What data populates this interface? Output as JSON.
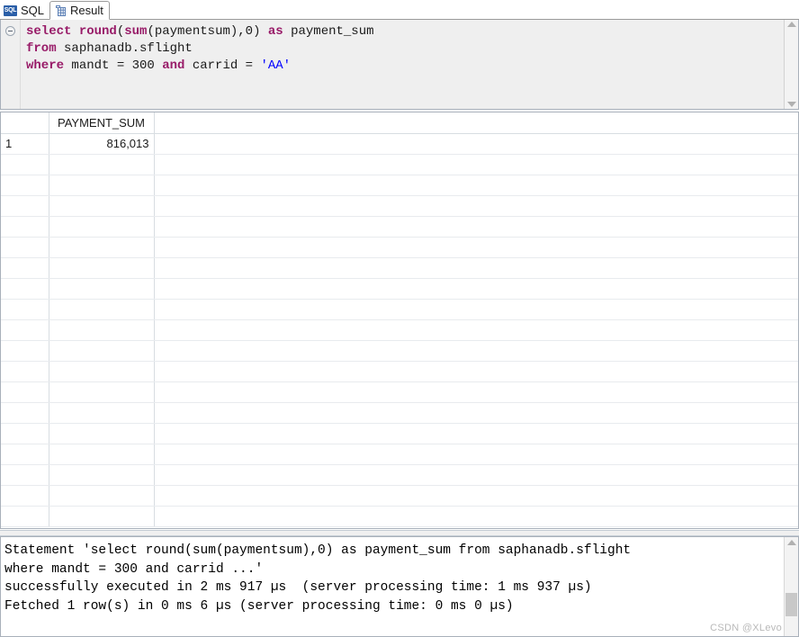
{
  "tabs": [
    {
      "label": "SQL",
      "icon": "sql-badge-icon",
      "active": false
    },
    {
      "label": "Result",
      "icon": "table-grid-icon",
      "active": true
    }
  ],
  "editor": {
    "fold_marker": "collapse-minus",
    "lines": [
      {
        "tokens": [
          {
            "t": "select ",
            "k": "kw"
          },
          {
            "t": "round",
            "k": "kw"
          },
          {
            "t": "(",
            "k": ""
          },
          {
            "t": "sum",
            "k": "kw"
          },
          {
            "t": "(paymentsum),0)",
            "k": ""
          },
          {
            "t": " as ",
            "k": "kw"
          },
          {
            "t": "payment_sum",
            "k": ""
          }
        ]
      },
      {
        "tokens": [
          {
            "t": "from",
            "k": "kw"
          },
          {
            "t": " saphanadb.sflight",
            "k": ""
          }
        ]
      },
      {
        "tokens": [
          {
            "t": "where",
            "k": "kw"
          },
          {
            "t": " mandt = 300 ",
            "k": ""
          },
          {
            "t": "and",
            "k": "kw"
          },
          {
            "t": " carrid = ",
            "k": ""
          },
          {
            "t": "'AA'",
            "k": "str"
          }
        ]
      }
    ],
    "scroll_up": "scroll-up-arrow",
    "scroll_down": "scroll-down-arrow"
  },
  "grid": {
    "columns": [
      "",
      "PAYMENT_SUM"
    ],
    "rows": [
      {
        "num": "1",
        "values": [
          "816,013"
        ]
      }
    ],
    "empty_row_count": 18
  },
  "console": {
    "lines": [
      "Statement 'select round(sum(paymentsum),0) as payment_sum from saphanadb.sflight",
      "where mandt = 300 and carrid ...'",
      "successfully executed in 2 ms 917 µs  (server processing time: 1 ms 937 µs)",
      "Fetched 1 row(s) in 0 ms 6 µs (server processing time: 0 ms 0 µs)"
    ]
  },
  "watermark": {
    "text": "CSDN @XLevo"
  },
  "colors": {
    "keyword": "#981b68",
    "string": "#0000ff",
    "tab_icon_blue": "#2b5fa8",
    "editor_bg": "#efefef",
    "border": "#a8b0ba"
  }
}
